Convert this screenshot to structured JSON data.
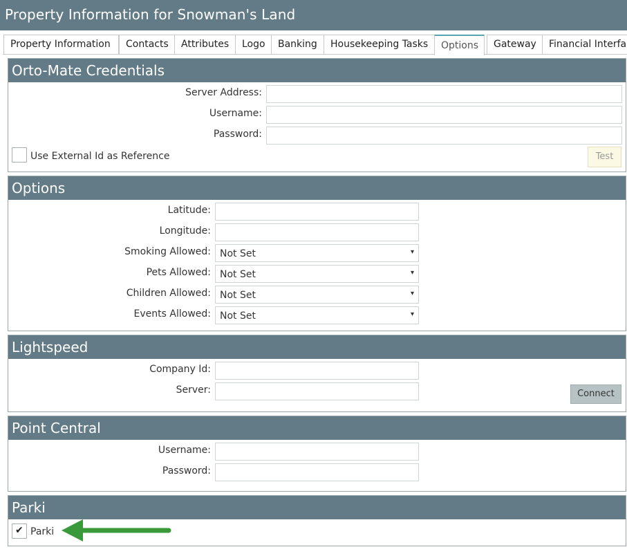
{
  "window": {
    "title": "Property Information for Snowman's Land"
  },
  "tabs": [
    {
      "label": "Property Information"
    },
    {
      "label": "Contacts"
    },
    {
      "label": "Attributes"
    },
    {
      "label": "Logo"
    },
    {
      "label": "Banking"
    },
    {
      "label": "Housekeeping Tasks"
    },
    {
      "label": "Options",
      "active": true
    },
    {
      "label": "Gateway"
    },
    {
      "label": "Financial Interfa"
    }
  ],
  "ortomate": {
    "title": "Orto-Mate Credentials",
    "server_label": "Server Address:",
    "server_value": "",
    "username_label": "Username:",
    "username_value": "",
    "password_label": "Password:",
    "password_value": "",
    "external_id_label": "Use External Id as Reference",
    "external_id_checked": false,
    "test_label": "Test"
  },
  "options": {
    "title": "Options",
    "latitude_label": "Latitude:",
    "latitude_value": "",
    "longitude_label": "Longitude:",
    "longitude_value": "",
    "smoking_label": "Smoking Allowed:",
    "smoking_value": "Not Set",
    "pets_label": "Pets Allowed:",
    "pets_value": "Not Set",
    "children_label": "Children Allowed:",
    "children_value": "Not Set",
    "events_label": "Events Allowed:",
    "events_value": "Not Set"
  },
  "lightspeed": {
    "title": "Lightspeed",
    "company_label": "Company Id:",
    "company_value": "",
    "server_label": "Server:",
    "server_value": "",
    "connect_label": "Connect"
  },
  "pointcentral": {
    "title": "Point Central",
    "username_label": "Username:",
    "username_value": "",
    "password_label": "Password:",
    "password_value": ""
  },
  "parki": {
    "title": "Parki",
    "checkbox_label": "Parki",
    "checked": true
  },
  "icons": {
    "check": "✔",
    "dropdown": "▾",
    "annotation_arrow_color": "#3a9a3a"
  },
  "colors": {
    "header_bg": "#637b86",
    "active_tab_accent": "#5aa3b1"
  }
}
